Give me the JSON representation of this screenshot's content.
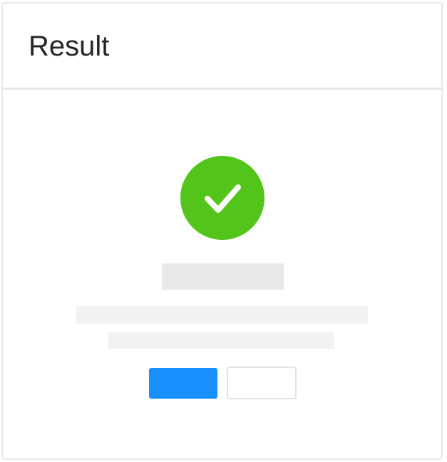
{
  "card": {
    "title": "Result"
  },
  "result": {
    "status": "success",
    "icon": "check-circle-icon",
    "icon_color": "#52c41a",
    "accent": "#1890ff",
    "skeleton_color": "#e9e9e9",
    "skeleton_light_color": "#f2f2f2",
    "border_color": "#e8e8e8"
  }
}
